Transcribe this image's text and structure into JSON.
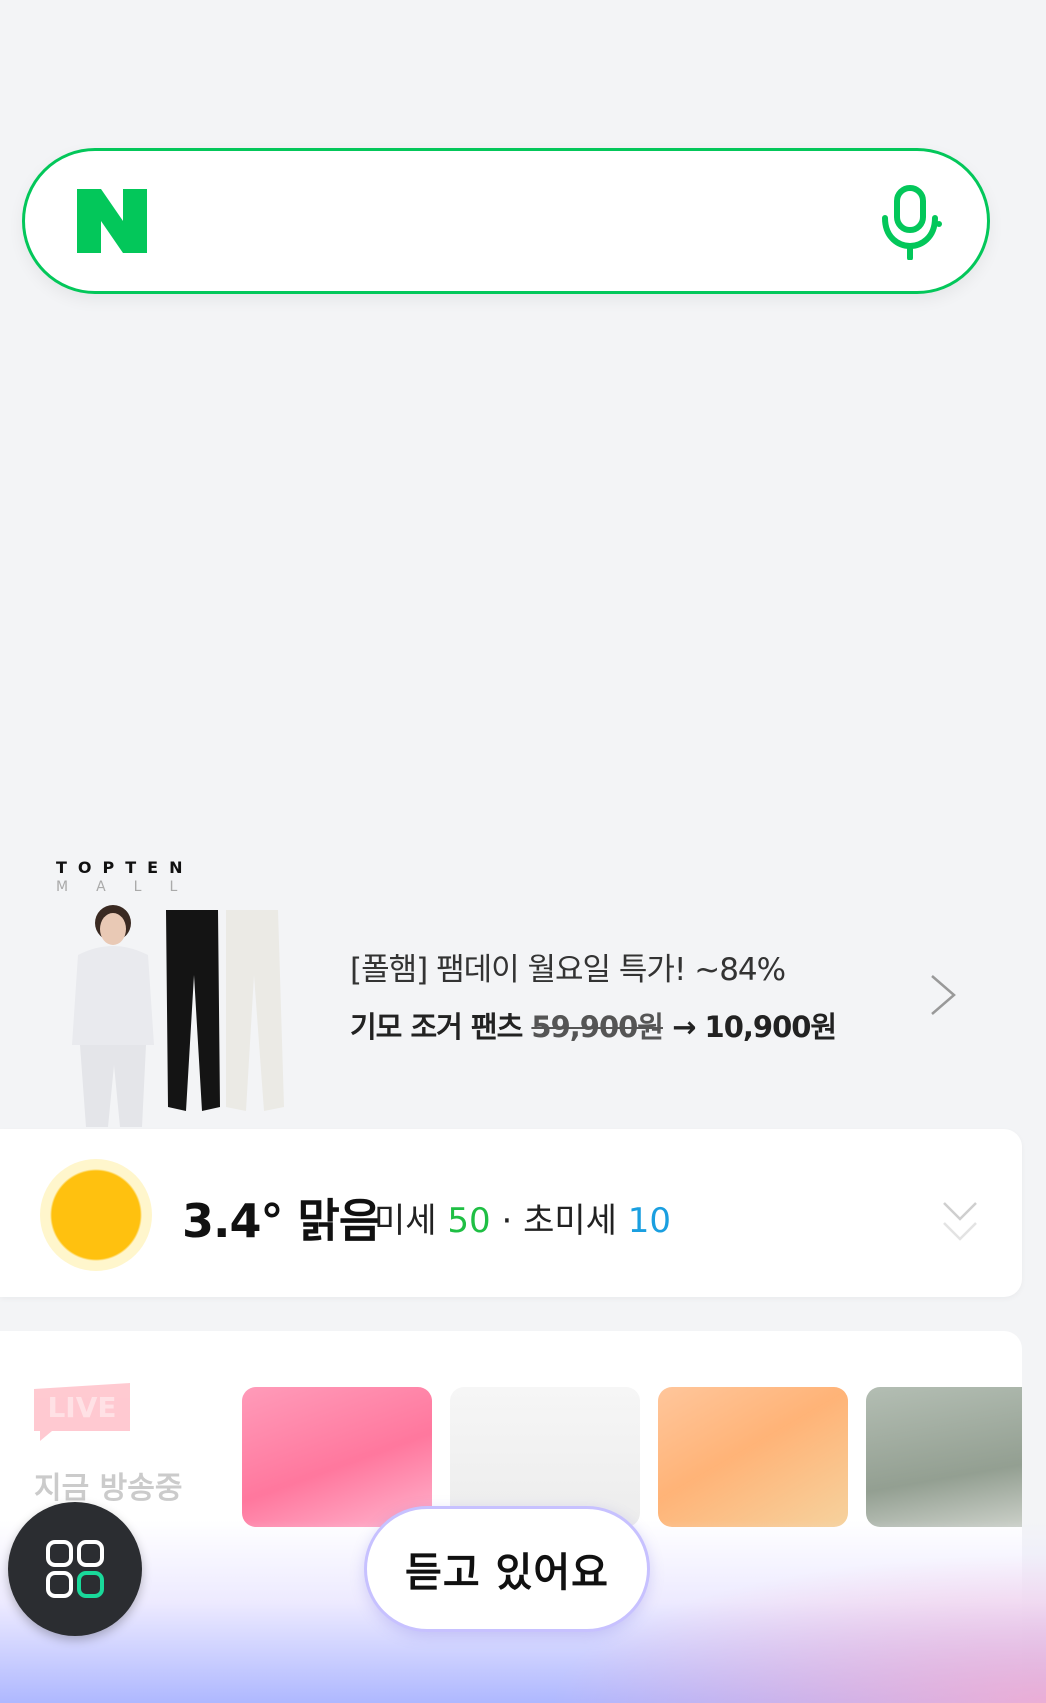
{
  "search": {
    "logo_icon": "naver-n-logo",
    "mic_icon": "microphone-icon",
    "accent_color": "#03c75a"
  },
  "ad": {
    "brand_name": "TOPTEN",
    "brand_sub": "MALL",
    "headline": "[폴햄] 팸데이 월요일 특가! ~84%",
    "product": "기모 조거 팬츠",
    "old_price": "59,900원",
    "arrow": "→",
    "new_price": "10,900원"
  },
  "weather": {
    "icon": "sun-icon",
    "temp_condition": "3.4° 맑음",
    "fine_dust_label": "미세",
    "fine_dust_value": "50",
    "separator": "·",
    "ultrafine_dust_label": "초미세",
    "ultrafine_dust_value": "10",
    "dust_good_color": "#1fbf44",
    "ultrafine_color": "#1a9fe0"
  },
  "live": {
    "badge": "LIVE",
    "subtitle": "지금 방송중"
  },
  "bottom": {
    "menu_icon": "app-grid-icon",
    "listening_label": "듣고 있어요"
  }
}
